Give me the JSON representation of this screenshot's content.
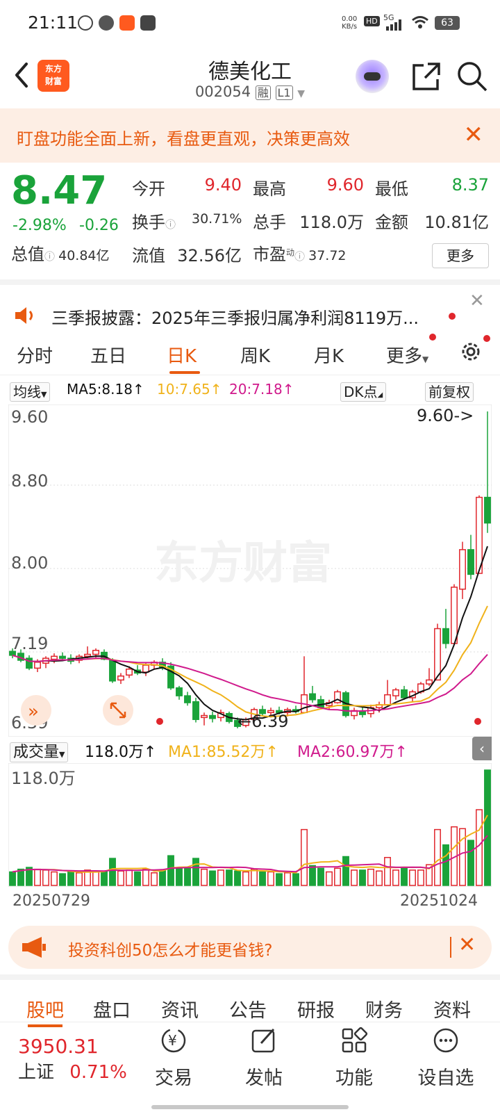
{
  "status_bar": {
    "time": "21:11",
    "net_speed_top": "0.00",
    "net_speed_unit": "KB/s",
    "hd": "HD",
    "signal": "5G",
    "battery": "63"
  },
  "header": {
    "title": "德美化工",
    "code": "002054",
    "badge_margin": "融",
    "badge_level": "L1",
    "logo_line1": "东方",
    "logo_line2": "财富"
  },
  "banner": {
    "text": "盯盘功能全面上新，看盘更直观，决策更高效",
    "close": "✕"
  },
  "quote": {
    "price": "8.47",
    "change_pct": "-2.98%",
    "change_abs": "-0.26",
    "open_label": "今开",
    "open": "9.40",
    "high_label": "最高",
    "high": "9.60",
    "low_label": "最低",
    "low": "8.37",
    "turnover_label": "换手",
    "turnover": "30.71%",
    "volume_label": "总手",
    "volume": "118.0万",
    "amount_label": "金额",
    "amount": "10.81亿",
    "mktcap_label": "总值",
    "mktcap": "40.84亿",
    "float_label": "流值",
    "float": "32.56亿",
    "pe_label": "市盈",
    "pe_sup": "动",
    "pe": "37.72",
    "more": "更多"
  },
  "news": {
    "text": "三季报披露：2025年三季报归属净利润8119万..."
  },
  "tabs": [
    "分时",
    "五日",
    "日K",
    "周K",
    "月K",
    "更多"
  ],
  "ma": {
    "selector": "均线",
    "ma5": "MA5:8.18",
    "ma10": "10:7.65",
    "ma20": "20:7.18",
    "dk": "DK点",
    "adjust": "前复权"
  },
  "chart_labels": {
    "y_top": "9.60",
    "y_880": "8.80",
    "y_800": "8.00",
    "y_719": "7.19",
    "y_bottom": "6.39",
    "high_marker": "9.60->",
    "low_marker": "←6.39",
    "watermark": "东方财富"
  },
  "volume": {
    "selector": "成交量",
    "value": "118.0万",
    "ma1": "MA1:85.52万",
    "ma2": "MA2:60.97万",
    "y_top": "118.0万"
  },
  "dates": {
    "start": "20250729",
    "end": "20251024"
  },
  "ad": {
    "text": "投资科创50怎么才能更省钱?"
  },
  "bottom_tabs": [
    "股吧",
    "盘口",
    "资讯",
    "公告",
    "研报",
    "财务",
    "资料"
  ],
  "bottom_bar": {
    "index_value": "3950.31",
    "index_name": "上证",
    "index_change": "0.71%",
    "trade": "交易",
    "post": "发帖",
    "functions": "功能",
    "watchlist": "设自选"
  },
  "colors": {
    "up": "#e0262c",
    "down": "#1aa33a",
    "accent": "#e85a10",
    "ma5": "#111111",
    "ma10": "#f0b21a",
    "ma20": "#d01a8c"
  },
  "chart_data": {
    "type": "candlestick",
    "x_range": [
      "20250729",
      "20251024"
    ],
    "ylim": [
      6.39,
      9.6
    ],
    "candles": [
      {
        "o": 7.17,
        "h": 7.2,
        "l": 7.1,
        "c": 7.13
      },
      {
        "o": 7.15,
        "h": 7.19,
        "l": 7.06,
        "c": 7.08
      },
      {
        "o": 7.1,
        "h": 7.13,
        "l": 6.98,
        "c": 7.0
      },
      {
        "o": 7.0,
        "h": 7.09,
        "l": 6.96,
        "c": 7.06
      },
      {
        "o": 7.05,
        "h": 7.12,
        "l": 7.0,
        "c": 7.1
      },
      {
        "o": 7.09,
        "h": 7.15,
        "l": 7.05,
        "c": 7.12
      },
      {
        "o": 7.12,
        "h": 7.16,
        "l": 7.08,
        "c": 7.1
      },
      {
        "o": 7.1,
        "h": 7.14,
        "l": 7.04,
        "c": 7.07
      },
      {
        "o": 7.08,
        "h": 7.14,
        "l": 7.05,
        "c": 7.12
      },
      {
        "o": 7.12,
        "h": 7.22,
        "l": 7.1,
        "c": 7.14
      },
      {
        "o": 7.14,
        "h": 7.2,
        "l": 7.1,
        "c": 7.18
      },
      {
        "o": 7.16,
        "h": 7.19,
        "l": 7.08,
        "c": 7.09
      },
      {
        "o": 7.08,
        "h": 7.1,
        "l": 6.85,
        "c": 6.87
      },
      {
        "o": 6.88,
        "h": 6.95,
        "l": 6.84,
        "c": 6.92
      },
      {
        "o": 6.93,
        "h": 7.02,
        "l": 6.9,
        "c": 6.99
      },
      {
        "o": 6.98,
        "h": 7.03,
        "l": 6.93,
        "c": 6.95
      },
      {
        "o": 6.96,
        "h": 7.05,
        "l": 6.92,
        "c": 7.03
      },
      {
        "o": 7.03,
        "h": 7.08,
        "l": 6.99,
        "c": 7.06
      },
      {
        "o": 7.06,
        "h": 7.1,
        "l": 6.98,
        "c": 7.0
      },
      {
        "o": 7.02,
        "h": 7.06,
        "l": 6.78,
        "c": 6.8
      },
      {
        "o": 6.8,
        "h": 6.82,
        "l": 6.68,
        "c": 6.72
      },
      {
        "o": 6.72,
        "h": 6.76,
        "l": 6.62,
        "c": 6.65
      },
      {
        "o": 6.66,
        "h": 6.7,
        "l": 6.45,
        "c": 6.48
      },
      {
        "o": 6.5,
        "h": 6.55,
        "l": 6.42,
        "c": 6.52
      },
      {
        "o": 6.52,
        "h": 6.56,
        "l": 6.45,
        "c": 6.49
      },
      {
        "o": 6.5,
        "h": 6.58,
        "l": 6.46,
        "c": 6.55
      },
      {
        "o": 6.54,
        "h": 6.56,
        "l": 6.44,
        "c": 6.46
      },
      {
        "o": 6.47,
        "h": 6.5,
        "l": 6.39,
        "c": 6.41
      },
      {
        "o": 6.42,
        "h": 6.5,
        "l": 6.4,
        "c": 6.48
      },
      {
        "o": 6.48,
        "h": 6.6,
        "l": 6.47,
        "c": 6.58
      },
      {
        "o": 6.58,
        "h": 6.62,
        "l": 6.52,
        "c": 6.54
      },
      {
        "o": 6.55,
        "h": 6.6,
        "l": 6.5,
        "c": 6.57
      },
      {
        "o": 6.57,
        "h": 6.61,
        "l": 6.53,
        "c": 6.55
      },
      {
        "o": 6.55,
        "h": 6.6,
        "l": 6.51,
        "c": 6.58
      },
      {
        "o": 6.58,
        "h": 6.62,
        "l": 6.54,
        "c": 6.56
      },
      {
        "o": 6.55,
        "h": 7.12,
        "l": 6.55,
        "c": 6.73
      },
      {
        "o": 6.74,
        "h": 6.82,
        "l": 6.65,
        "c": 6.68
      },
      {
        "o": 6.68,
        "h": 6.72,
        "l": 6.58,
        "c": 6.6
      },
      {
        "o": 6.62,
        "h": 6.68,
        "l": 6.58,
        "c": 6.65
      },
      {
        "o": 6.65,
        "h": 6.78,
        "l": 6.64,
        "c": 6.76
      },
      {
        "o": 6.75,
        "h": 6.77,
        "l": 6.5,
        "c": 6.52
      },
      {
        "o": 6.52,
        "h": 6.6,
        "l": 6.48,
        "c": 6.57
      },
      {
        "o": 6.56,
        "h": 6.62,
        "l": 6.5,
        "c": 6.53
      },
      {
        "o": 6.54,
        "h": 6.63,
        "l": 6.5,
        "c": 6.6
      },
      {
        "o": 6.6,
        "h": 6.66,
        "l": 6.55,
        "c": 6.63
      },
      {
        "o": 6.63,
        "h": 6.88,
        "l": 6.62,
        "c": 6.73
      },
      {
        "o": 6.72,
        "h": 6.8,
        "l": 6.68,
        "c": 6.78
      },
      {
        "o": 6.78,
        "h": 6.82,
        "l": 6.68,
        "c": 6.7
      },
      {
        "o": 6.7,
        "h": 6.78,
        "l": 6.66,
        "c": 6.76
      },
      {
        "o": 6.76,
        "h": 6.86,
        "l": 6.74,
        "c": 6.84
      },
      {
        "o": 6.84,
        "h": 7.0,
        "l": 6.82,
        "c": 6.88
      },
      {
        "o": 6.88,
        "h": 7.45,
        "l": 6.88,
        "c": 7.4
      },
      {
        "o": 7.4,
        "h": 7.6,
        "l": 7.2,
        "c": 7.25
      },
      {
        "o": 7.25,
        "h": 7.85,
        "l": 7.25,
        "c": 7.82
      },
      {
        "o": 7.8,
        "h": 8.28,
        "l": 7.7,
        "c": 8.2
      },
      {
        "o": 8.2,
        "h": 8.35,
        "l": 7.9,
        "c": 7.95
      },
      {
        "o": 7.96,
        "h": 8.75,
        "l": 7.96,
        "c": 8.73
      },
      {
        "o": 8.73,
        "h": 9.6,
        "l": 8.37,
        "c": 8.47
      }
    ],
    "ma_lines": [
      "MA5",
      "MA10",
      "MA20"
    ],
    "volume_ylim": [
      0,
      118.0
    ]
  }
}
